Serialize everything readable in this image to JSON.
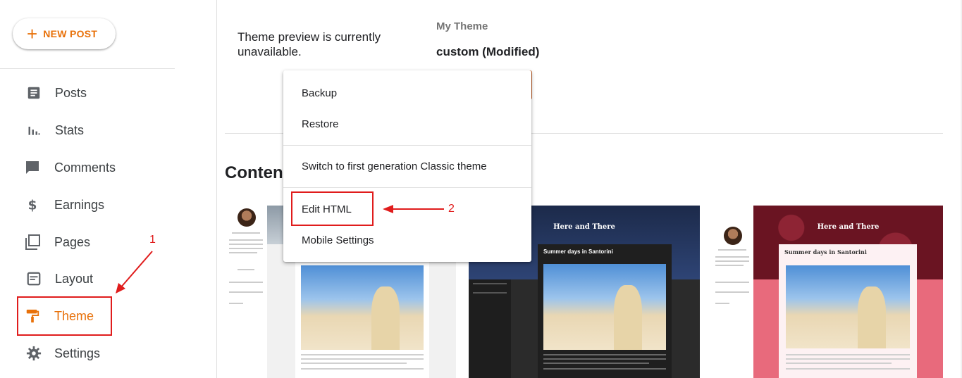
{
  "sidebar": {
    "new_post": "NEW POST",
    "items": [
      {
        "label": "Posts",
        "icon": "posts-icon"
      },
      {
        "label": "Stats",
        "icon": "stats-icon"
      },
      {
        "label": "Comments",
        "icon": "comments-icon"
      },
      {
        "label": "Earnings",
        "icon": "earnings-icon"
      },
      {
        "label": "Pages",
        "icon": "pages-icon"
      },
      {
        "label": "Layout",
        "icon": "layout-icon"
      },
      {
        "label": "Theme",
        "icon": "theme-icon",
        "active": true
      },
      {
        "label": "Settings",
        "icon": "gear-icon"
      }
    ]
  },
  "main": {
    "preview_message": "Theme preview is currently unavailable.",
    "my_theme_label": "My Theme",
    "theme_name": "custom (Modified)",
    "content_heading": "Conten"
  },
  "menu": {
    "items": [
      "Backup",
      "Restore",
      "Switch to first generation Classic theme",
      "Edit HTML",
      "Mobile Settings"
    ]
  },
  "thumbnails": [
    {
      "blog_title": "",
      "post_title": ""
    },
    {
      "blog_title": "Here and There",
      "post_title": "Summer days in Santorini"
    },
    {
      "blog_title": "Here and There",
      "post_title": "Summer days in Santorini"
    }
  ],
  "annotations": {
    "step1": "1",
    "step2": "2"
  },
  "colors": {
    "accent": "#e8710a",
    "annotation": "#e01c1c",
    "text": "#202124"
  }
}
